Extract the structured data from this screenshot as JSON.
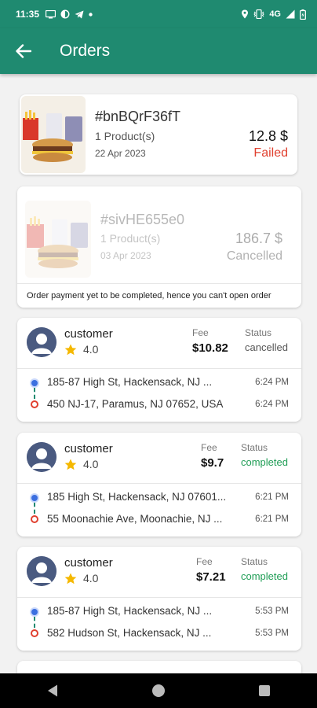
{
  "status_bar": {
    "time": "11:35",
    "network": "4G",
    "icons": [
      "message-icon",
      "app-icon",
      "telegram-icon",
      "dot-icon",
      "location-icon",
      "vibrate-icon",
      "signal-icon",
      "battery-icon"
    ]
  },
  "app_bar": {
    "title": "Orders",
    "back_icon": "arrow-left-icon"
  },
  "colors": {
    "primary": "#1f8a70",
    "failed": "#e0402f",
    "completed": "#1f9d55",
    "cancelled": "#555555"
  },
  "orders": [
    {
      "id": "#bnBQrF36fT",
      "products": "1 Product(s)",
      "date": "22 Apr 2023",
      "amount": "12.8 $",
      "status": "Failed",
      "note": ""
    },
    {
      "id": "#sivHE655e0",
      "products": "1 Product(s)",
      "date": "03 Apr 2023",
      "amount": "186.7 $",
      "status": "Cancelled",
      "note": "Order payment yet to be completed, hence you can't open order"
    }
  ],
  "rides": [
    {
      "customer": "customer",
      "rating": "4.0",
      "fee_label": "Fee",
      "fee": "$10.82",
      "status_label": "Status",
      "status": "cancelled",
      "pickup": "185-87 High St, Hackensack, NJ ...",
      "pickup_time": "6:24 PM",
      "dropoff": "450 NJ-17, Paramus, NJ 07652, USA",
      "dropoff_time": "6:24 PM"
    },
    {
      "customer": "customer",
      "rating": "4.0",
      "fee_label": "Fee",
      "fee": "$9.7",
      "status_label": "Status",
      "status": "completed",
      "pickup": "185 High St, Hackensack, NJ 07601...",
      "pickup_time": "6:21 PM",
      "dropoff": "55 Moonachie Ave, Moonachie, NJ ...",
      "dropoff_time": "6:21 PM"
    },
    {
      "customer": "customer",
      "rating": "4.0",
      "fee_label": "Fee",
      "fee": "$7.21",
      "status_label": "Status",
      "status": "completed",
      "pickup": "185-87 High St, Hackensack, NJ ...",
      "pickup_time": "5:53 PM",
      "dropoff": "582 Hudson St, Hackensack, NJ ...",
      "dropoff_time": "5:53 PM"
    }
  ],
  "nav_bar": [
    "back-triangle-icon",
    "home-circle-icon",
    "recents-square-icon"
  ]
}
